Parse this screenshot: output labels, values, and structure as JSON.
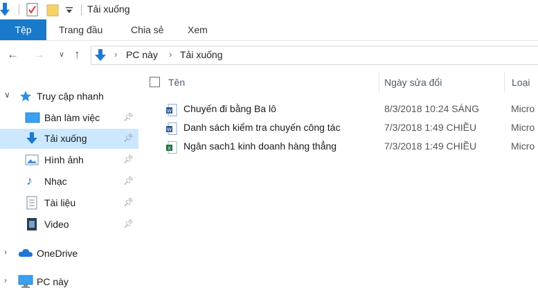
{
  "window": {
    "title": "Tải xuống"
  },
  "ribbon": {
    "tabs": [
      {
        "label": "Tệp"
      },
      {
        "label": "Trang đầu"
      },
      {
        "label": "Chia sẻ"
      },
      {
        "label": "Xem"
      }
    ]
  },
  "address": {
    "crumbs": [
      "PC này",
      "Tải xuống"
    ]
  },
  "navpane": {
    "quick_access": "Truy cập nhanh",
    "items": [
      {
        "label": "Bàn làm việc",
        "icon": "desktop-icon"
      },
      {
        "label": "Tải xuống",
        "icon": "download-icon"
      },
      {
        "label": "Hình ảnh",
        "icon": "pictures-icon"
      },
      {
        "label": "Nhạc",
        "icon": "music-icon"
      },
      {
        "label": "Tài liệu",
        "icon": "documents-icon"
      },
      {
        "label": "Video",
        "icon": "video-icon"
      }
    ],
    "onedrive": "OneDrive",
    "this_pc": "PC này"
  },
  "filelist": {
    "columns": {
      "name": "Tên",
      "date": "Ngày sửa đổi",
      "type": "Loại"
    },
    "files": [
      {
        "name": "Chuyến đi bằng Ba lô",
        "date": "8/3/2018 10:24 SÁNG",
        "type": "Micro",
        "icon": "word-doc-icon"
      },
      {
        "name": "Danh sách kiểm tra chuyến công tác",
        "date": "7/3/2018 1:49 CHIỀU",
        "type": "Micro",
        "icon": "word-doc-icon"
      },
      {
        "name": "Ngân sach1 kinh doanh hàng thẳng",
        "date": "7/3/2018 1:49 CHIỀU",
        "type": "Micro",
        "icon": "excel-doc-icon"
      }
    ]
  },
  "colors": {
    "accent": "#1979ca",
    "selection": "#cce8ff"
  }
}
